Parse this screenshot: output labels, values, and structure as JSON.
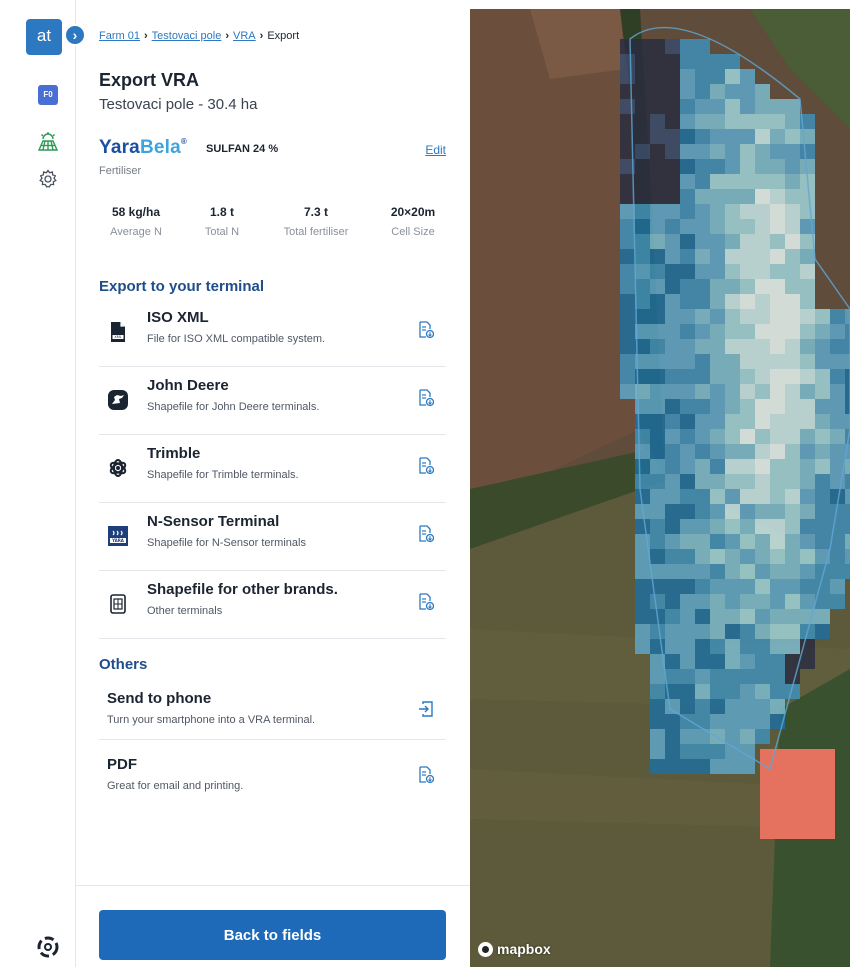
{
  "rail": {
    "logo_text": "at",
    "toggle_glyph": "›",
    "farm_badge": "F0",
    "icons": [
      "fields-icon",
      "settings-icon",
      "support-icon"
    ],
    "accent": "#2c79c1"
  },
  "breadcrumb": {
    "items": [
      "Farm 01",
      "Testovaci pole",
      "VRA"
    ],
    "current": "Export",
    "separator": "›"
  },
  "header": {
    "title": "Export VRA",
    "subtitle": "Testovaci pole - 30.4 ha"
  },
  "product": {
    "brand_yara": "Yara",
    "brand_bela": "Bela",
    "brand_tm": "®",
    "name": "SULFAN 24 %",
    "type": "Fertiliser",
    "edit_label": "Edit"
  },
  "stats": [
    {
      "value": "58 kg/ha",
      "label": "Average N"
    },
    {
      "value": "1.8 t",
      "label": "Total N"
    },
    {
      "value": "7.3 t",
      "label": "Total fertiliser"
    },
    {
      "value": "20×20m",
      "label": "Cell Size"
    }
  ],
  "export_section": {
    "title": "Export to your terminal",
    "items": [
      {
        "name": "ISO XML",
        "desc": "File for ISO XML compatible system.",
        "icon": "xml-file-icon"
      },
      {
        "name": "John Deere",
        "desc": "Shapefile for John Deere terminals.",
        "icon": "john-deere-icon"
      },
      {
        "name": "Trimble",
        "desc": "Shapefile for Trimble terminals.",
        "icon": "trimble-icon"
      },
      {
        "name": "N-Sensor Terminal",
        "desc": "Shapefile for N-Sensor terminals",
        "icon": "n-sensor-icon"
      },
      {
        "name": "Shapefile for other brands.",
        "desc": "Other terminals",
        "icon": "terminal-device-icon"
      }
    ]
  },
  "others_section": {
    "title": "Others",
    "items": [
      {
        "name": "Send to phone",
        "desc": "Turn your smartphone into a VRA terminal.",
        "icon": "send-to-phone-icon"
      },
      {
        "name": "PDF",
        "desc": "Great for email and printing.",
        "icon": "download-file-icon"
      }
    ]
  },
  "footer": {
    "back_label": "Back to fields"
  },
  "map": {
    "attribution": "mapbox",
    "zone_colors": [
      "#2a2d3f",
      "#3a4a6b",
      "#1f6f9e",
      "#3f8fb8",
      "#5ea6c8",
      "#7dbccf",
      "#9fd3d9",
      "#c8e8e8",
      "#e8f4f2",
      "#e5715f"
    ]
  }
}
